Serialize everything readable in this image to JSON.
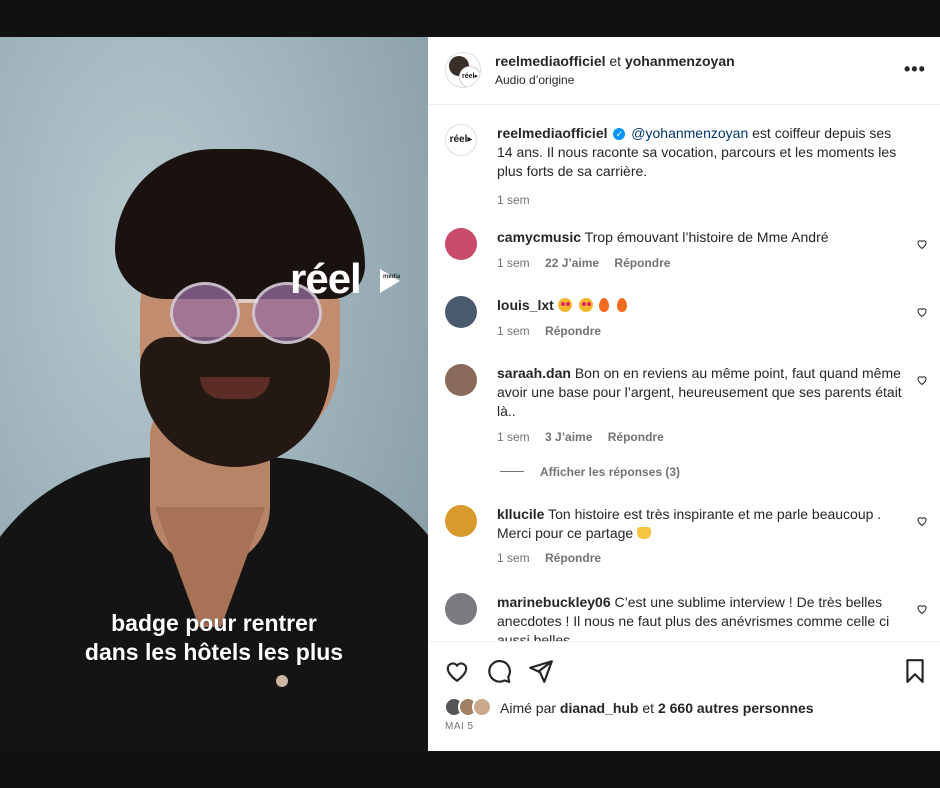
{
  "video": {
    "logo_text": "réel",
    "logo_sub": "média",
    "caption_line1": "badge pour rentrer",
    "caption_line2": "dans les hôtels les plus"
  },
  "header": {
    "username1": "reelmediaofficiel",
    "conjunction": "et",
    "username2": "yohanmenzoyan",
    "audio": "Audio d’origine",
    "avatar_text": "réel▸",
    "more_label": "•••"
  },
  "post": {
    "username": "reelmediaofficiel",
    "verified_mark": "✓",
    "mention": "@yohanmenzoyan",
    "text": " est coiffeur depuis ses 14 ans. Il nous raconte sa vocation, parcours et les moments les plus forts de sa carrière.",
    "time": "1 sem",
    "avatar_text": "réel▸"
  },
  "comments": [
    {
      "username": "camycmusic",
      "text": "Trop émouvant l’histoire de Mme André",
      "time": "1 sem",
      "likes": "22 J’aime",
      "reply": "Répondre",
      "avatar_color": "#c94a6a"
    },
    {
      "username": "louis_lxt",
      "text": "",
      "time": "1 sem",
      "likes": "",
      "reply": "Répondre",
      "avatar_color": "#4a5a6e"
    },
    {
      "username": "saraah.dan",
      "text": "Bon on en reviens au même point, faut quand même avoir une base pour l’argent, heureusement que ses parents était là..",
      "time": "1 sem",
      "likes": "3 J’aime",
      "reply": "Répondre",
      "avatar_color": "#8a6a5a"
    },
    {
      "username": "kllucile",
      "text": "Ton histoire est très inspirante et me parle beaucoup . Merci pour ce partage",
      "time": "1 sem",
      "likes": "",
      "reply": "Répondre",
      "avatar_color": "#d99a2b"
    },
    {
      "username": "marinebuckley06",
      "text": "C’est une sublime interview ! De très belles anecdotes ! Il nous ne faut plus des anévrismes comme celle ci aussi belles",
      "avatar_color": "#7a7a80"
    }
  ],
  "view_replies": "Afficher les réponses (3)",
  "likes": {
    "prefix": "Aimé par",
    "user": "dianad_hub",
    "middle": "et",
    "others": "2 660 autres personnes"
  },
  "date": "MAI 5"
}
